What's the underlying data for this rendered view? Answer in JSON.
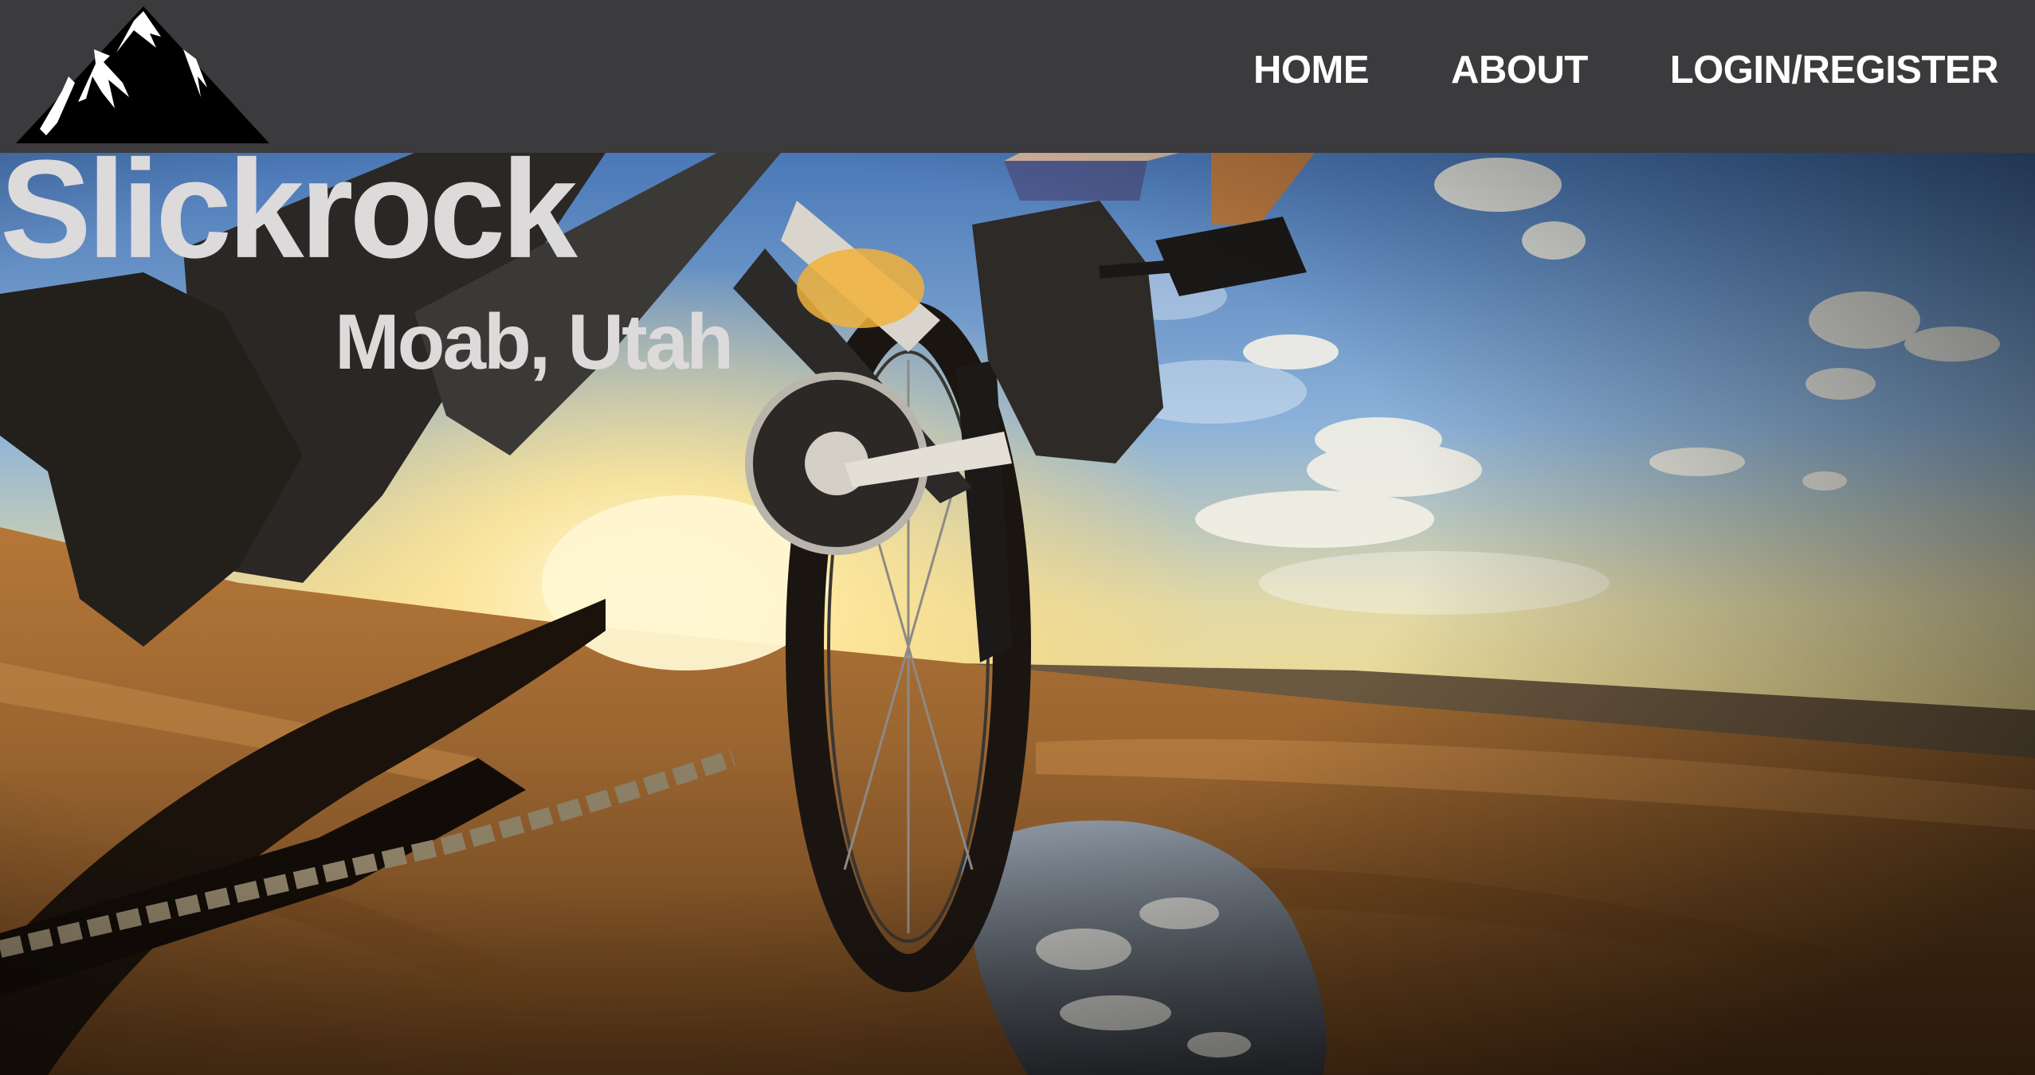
{
  "header": {
    "logo_icon": "mountain-logo-icon",
    "nav": [
      {
        "label": "HOME"
      },
      {
        "label": "ABOUT"
      },
      {
        "label": "LOGIN/REGISTER"
      }
    ]
  },
  "hero": {
    "title": "Slickrock",
    "subtitle": "Moab, Utah",
    "image": "mountain bike on slickrock at sunset"
  },
  "colors": {
    "navbar": "#3b3a3c",
    "nav_text": "#ffffff",
    "hero_text": "#dcdada"
  }
}
